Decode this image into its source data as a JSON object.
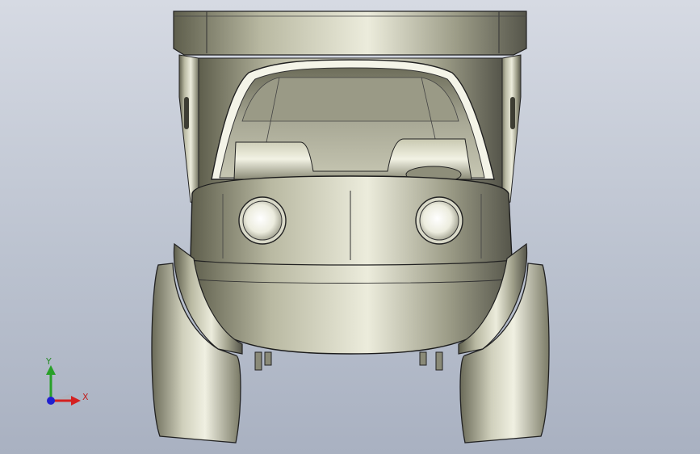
{
  "viewport": {
    "background_top": "#d6dae3",
    "background_bottom": "#a9b1c1",
    "model": "toy-truck-front-view"
  },
  "triad": {
    "y_label": "Y",
    "x_label": "X",
    "x_color": "#d42020",
    "y_color": "#28a028",
    "z_color": "#2020d0"
  }
}
